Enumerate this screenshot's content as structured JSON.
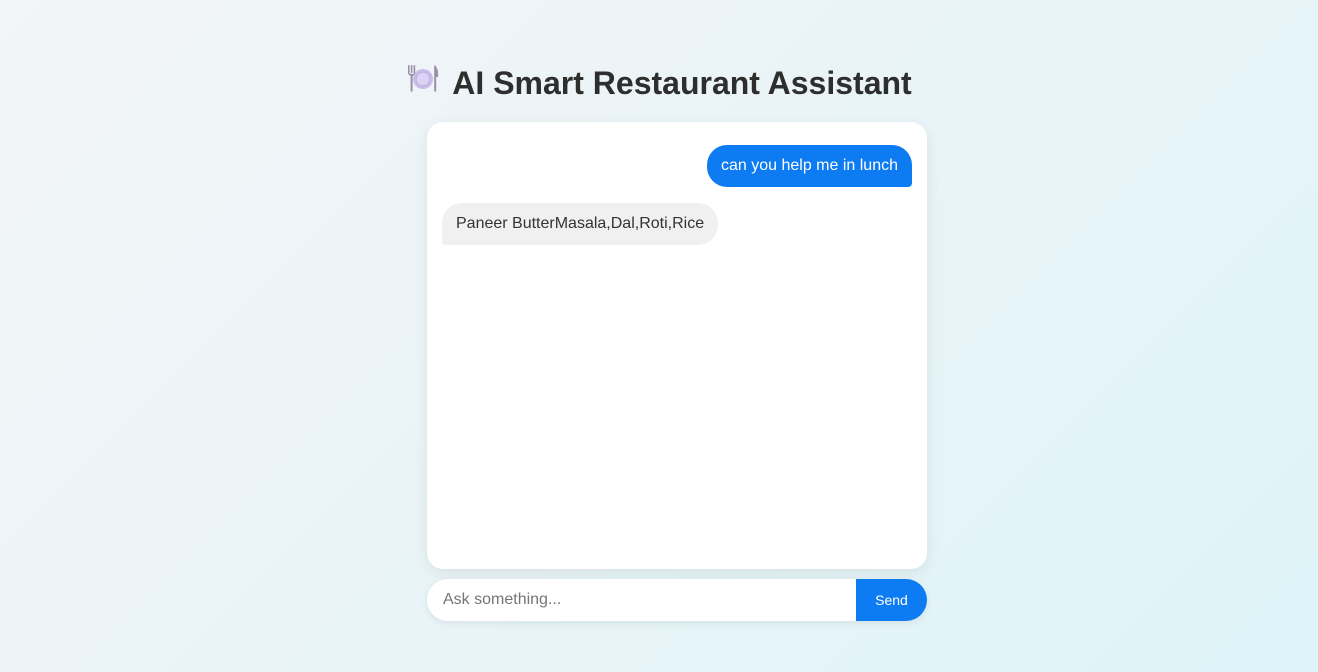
{
  "header": {
    "icon": "plate-with-cutlery-icon",
    "title": "AI Smart Restaurant Assistant"
  },
  "chat": {
    "messages": [
      {
        "role": "user",
        "text": "can you help me in lunch"
      },
      {
        "role": "assistant",
        "text": "Paneer ButterMasala,Dal,Roti,Rice"
      }
    ]
  },
  "composer": {
    "placeholder": "Ask something...",
    "value": "",
    "send_label": "Send"
  },
  "colors": {
    "accent": "#0d7bf2",
    "bot_bubble": "#f0f0f0",
    "title_text": "#2e2e2e"
  }
}
